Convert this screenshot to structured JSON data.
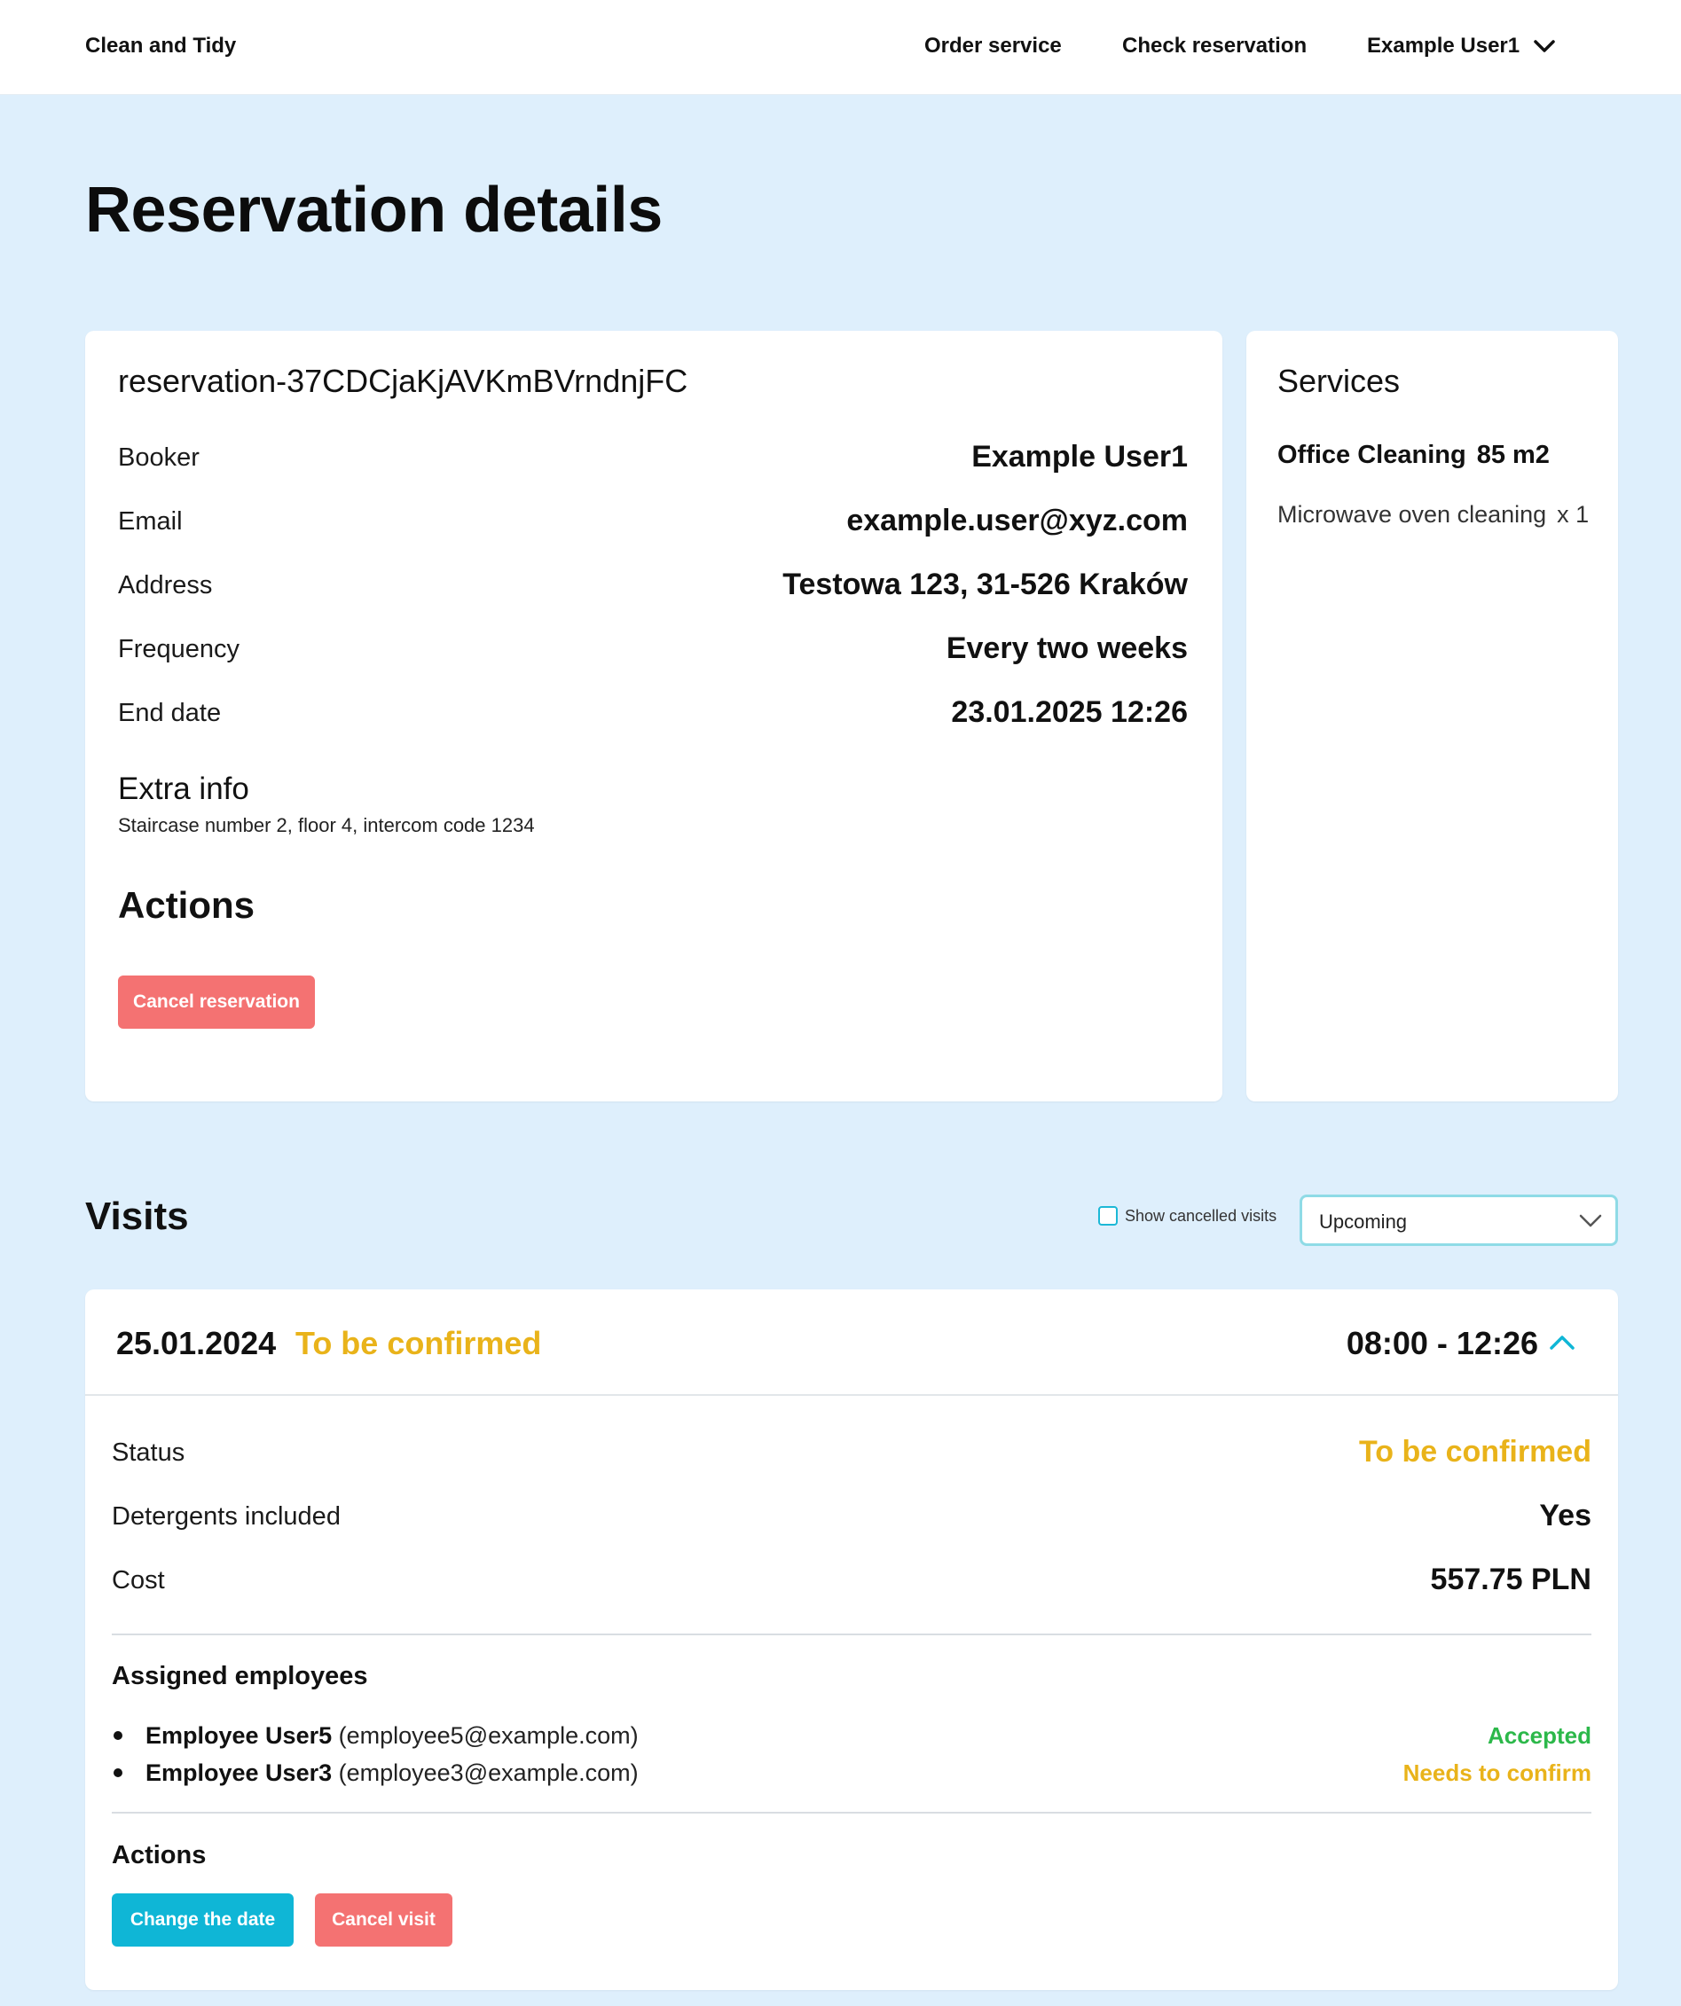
{
  "colors": {
    "page_bg": "#deeffc",
    "accent_cyan": "#0fb6d6",
    "danger_red": "#f47272",
    "status_pending": "#e9b31a",
    "status_accepted": "#2cb84a"
  },
  "header": {
    "brand": "Clean and Tidy",
    "nav": [
      "Order service",
      "Check reservation"
    ],
    "user": "Example User1",
    "user_icon": "chevron-down-icon"
  },
  "page_title": "Reservation details",
  "reservation": {
    "id": "reservation-37CDCjaKjAVKmBVrndnjFC",
    "details": [
      {
        "label": "Booker",
        "value": "Example User1"
      },
      {
        "label": "Email",
        "value": "example.user@xyz.com"
      },
      {
        "label": "Address",
        "value": "Testowa 123, 31-526 Kraków"
      },
      {
        "label": "Frequency",
        "value": "Every two weeks"
      },
      {
        "label": "End date",
        "value": "23.01.2025 12:26"
      }
    ],
    "extra_info_title": "Extra info",
    "extra_info": "Staircase number 2, floor 4, intercom code 1234",
    "actions_title": "Actions",
    "cancel_button": "Cancel reservation"
  },
  "services": {
    "title": "Services",
    "main": {
      "name": "Office Cleaning",
      "area": "85 m2"
    },
    "extras": [
      {
        "name": "Microwave oven cleaning",
        "qty": "x 1"
      }
    ]
  },
  "visits": {
    "title": "Visits",
    "show_cancelled_label": "Show cancelled visits",
    "show_cancelled_checked": false,
    "filter_value": "Upcoming",
    "items": [
      {
        "date": "25.01.2024",
        "status_label": "To be confirmed",
        "time": "08:00 - 12:26",
        "expanded": true,
        "details": [
          {
            "label": "Status",
            "value": "To be confirmed"
          },
          {
            "label": "Detergents included",
            "value": "Yes"
          },
          {
            "label": "Cost",
            "value": "557.75 PLN"
          }
        ],
        "employees_title": "Assigned employees",
        "employees": [
          {
            "name": "Employee User5",
            "email": "(employee5@example.com)",
            "status": "Accepted"
          },
          {
            "name": "Employee User3",
            "email": "(employee3@example.com)",
            "status": "Needs to confirm"
          }
        ],
        "actions_title": "Actions",
        "change_button": "Change the date",
        "cancel_button": "Cancel visit"
      }
    ]
  }
}
